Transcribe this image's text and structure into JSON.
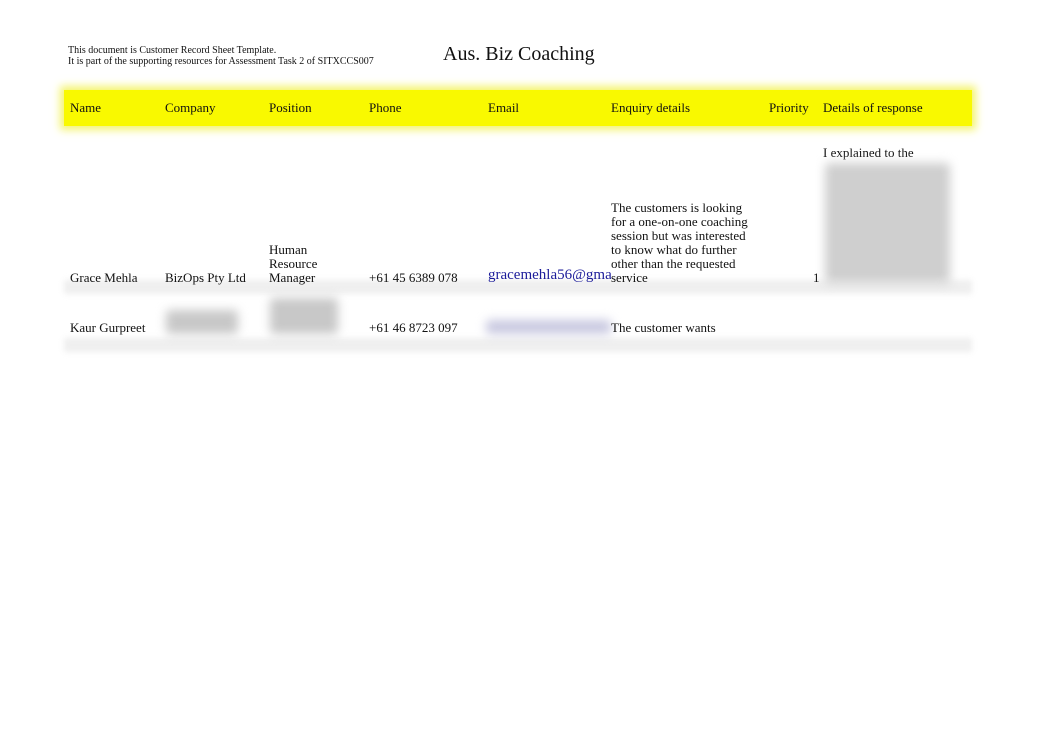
{
  "header": {
    "note_line1": "This document is Customer Record Sheet Template.",
    "note_line2": "It is part of the supporting resources for Assessment Task 2 of SITXCCS007",
    "title": "Aus. Biz Coaching"
  },
  "table": {
    "columns": [
      "Name",
      "Company",
      "Position",
      "Phone",
      "Email",
      "Enquiry details",
      "Priority",
      "Details of response"
    ],
    "highlight_color": "#f9f900",
    "rows": [
      {
        "name": "Grace Mehla",
        "company": "BizOps Pty Ltd",
        "position": "Human Resource Manager",
        "phone": "+61 45 6389 078",
        "email": "gracemehla56@gma",
        "enquiry": "The customers is looking for a one-on-one coaching session but was interested to know what do further other than the requested service",
        "priority": "1",
        "response": "I explained to the"
      },
      {
        "name": "Kaur Gurpreet",
        "phone": "+61 46 8723 097",
        "enquiry": "The customer wants"
      }
    ]
  }
}
